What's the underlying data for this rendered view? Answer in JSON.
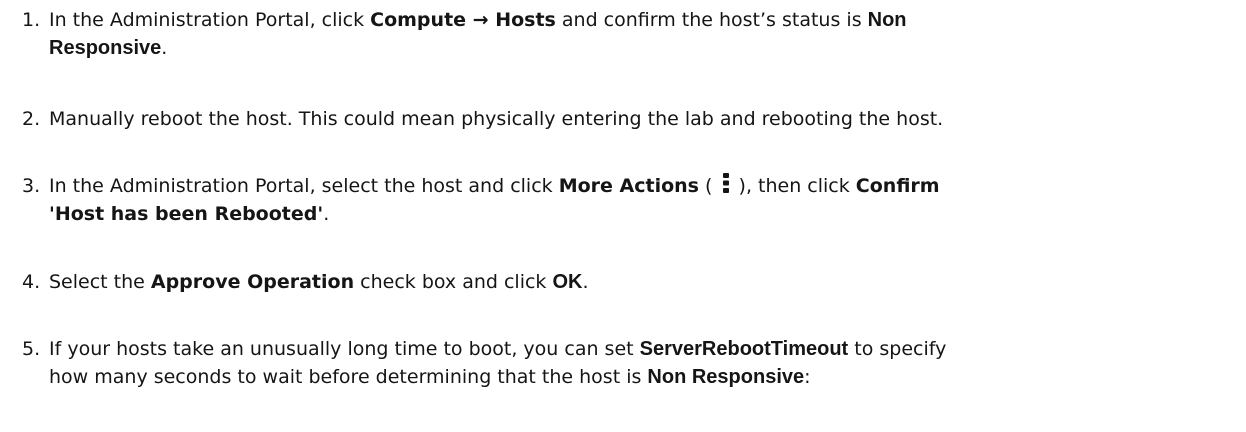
{
  "steps": [
    {
      "number": "1.",
      "line1": {
        "t1": "In the Administration Portal, click ",
        "gui1": "Compute",
        "arrow": " → ",
        "gui2": "Hosts",
        "t2": " and confirm the host’s status is ",
        "strong": "Non"
      },
      "line2": {
        "strong": "Responsive",
        "t1": "."
      }
    },
    {
      "number": "2.",
      "text": "Manually reboot the host. This could mean physically entering the lab and rebooting the host."
    },
    {
      "number": "3.",
      "line1": {
        "t1": "In the Administration Portal, select the host and click ",
        "gui1": "More Actions",
        "t2": " ( ",
        "icon": "kebab-vertical-icon",
        "t3": " ), then click ",
        "gui2": "Confirm"
      },
      "line2": {
        "gui": "'Host has been Rebooted'",
        "t1": "."
      }
    },
    {
      "number": "4.",
      "t1": "Select the ",
      "gui1": "Approve Operation",
      "t2": " check box and click ",
      "strong": "OK",
      "t3": "."
    },
    {
      "number": "5.",
      "line1": {
        "t1": "If your hosts take an unusually long time to boot, you can set ",
        "strong": "ServerRebootTimeout",
        "t2": " to specify"
      },
      "line2": {
        "t1": "how many seconds to wait before determining that the host is ",
        "strong": "Non Responsive",
        "t2": ":"
      }
    }
  ]
}
